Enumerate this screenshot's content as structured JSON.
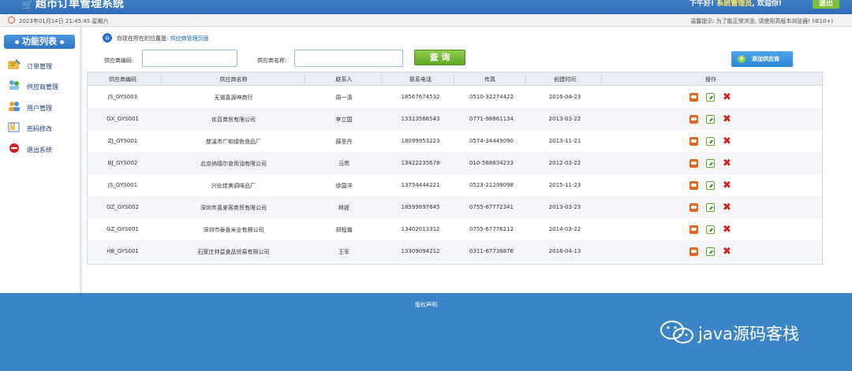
{
  "header": {
    "title": "超市订单管理系统",
    "welcome_prefix": "下午好!",
    "admin": "系统管理员",
    "welcome_suffix": ", 欢迎你!",
    "exit_label": "退出"
  },
  "info": {
    "datetime": "2023年01月14日 21:45:45 星期六",
    "tip": "温馨提示: 为了能正常浏览, 请使用高版本浏览器! (IE10+)"
  },
  "sidebar": {
    "title": "功能列表",
    "items": [
      {
        "label": "订单管理",
        "icon": "order-icon"
      },
      {
        "label": "供应商管理",
        "icon": "provider-icon"
      },
      {
        "label": "用户管理",
        "icon": "users-icon"
      },
      {
        "label": "密码修改",
        "icon": "password-icon"
      },
      {
        "label": "退出系统",
        "icon": "exit-icon"
      }
    ]
  },
  "breadcrumb": {
    "prefix": "你现在所在的位置是:",
    "current": "供应商管理页面"
  },
  "filters": {
    "code_label": "供应商编码:",
    "code_value": "",
    "name_label": "供应商名称:",
    "name_value": "",
    "query_label": "查 询",
    "add_label": "添加供应商"
  },
  "table": {
    "columns": [
      "供应商编码",
      "供应商名称",
      "联系人",
      "联系电话",
      "传真",
      "创建时间",
      "操作"
    ],
    "rows": [
      [
        "JS_GYS003",
        "无锡喜源坤商行",
        "周一清",
        "18567674532",
        "0510-32274422",
        "2016-04-23"
      ],
      [
        "GX_GYS001",
        "优百商贸有限公司",
        "李立国",
        "13323566543",
        "0771-98861134",
        "2013-03-22"
      ],
      [
        "ZJ_GYS001",
        "慈溪市广和绿色食品厂",
        "薛圣丹",
        "18099953223",
        "0574-34449090",
        "2013-11-21"
      ],
      [
        "BJ_GYS002",
        "北京纳福尔食用油有限公司",
        "马莺",
        "13422235678",
        "010-588634233",
        "2012-03-22"
      ],
      [
        "JS_GYS001",
        "兴化佳美调味品厂",
        "徐国洋",
        "13754444221",
        "0523-21299098",
        "2015-11-23"
      ],
      [
        "GZ_GYS002",
        "深圳市喜来客商贸有限公司",
        "林妮",
        "18599897645",
        "0755-67772341",
        "2013-03-23"
      ],
      [
        "GZ_GYS001",
        "深圳市泰香米业有限公司",
        "郑程瀚",
        "13402013312",
        "0755-67776212",
        "2014-03-22"
      ],
      [
        "HB_GYS001",
        "石家庄帅益食品贸易有限公司",
        "王军",
        "13309094212",
        "0311-67738876",
        "2016-04-13"
      ]
    ]
  },
  "footer": {
    "copyright": "版权声明"
  },
  "watermark": {
    "text": "java源码客栈"
  }
}
